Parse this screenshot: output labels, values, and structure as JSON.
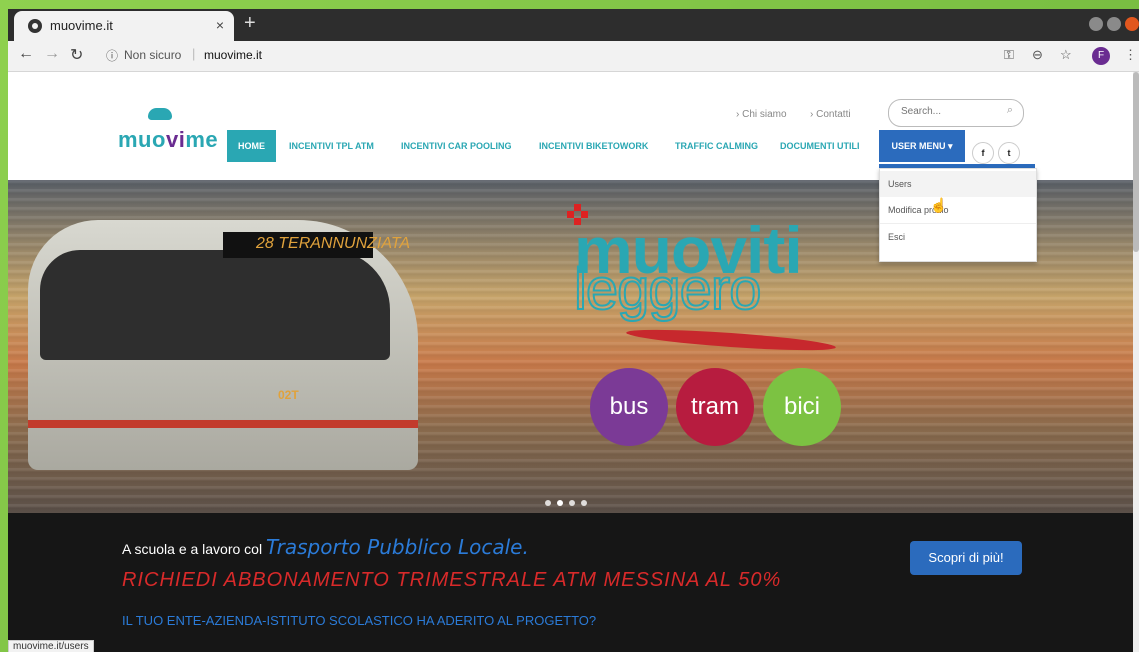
{
  "browser": {
    "tab_title": "muovime.it",
    "tab_close": "×",
    "new_tab": "+",
    "address_security": "Non sicuro",
    "address_url": "muovime.it",
    "profile_initial": "F",
    "status_url": "muovime.it/users"
  },
  "site": {
    "logo_text_a": "muo",
    "logo_text_b": "vi",
    "logo_text_c": "me",
    "top_links": [
      "› Chi siamo",
      "› Contatti"
    ],
    "search_placeholder": "Search...",
    "menu": [
      "HOME",
      "INCENTIVI TPL ATM",
      "INCENTIVI CAR POOLING",
      "INCENTIVI BIKETOWORK",
      "TRAFFIC CALMING",
      "DOCUMENTI UTILI",
      "USER MENU ▾"
    ],
    "social": [
      "f",
      "t"
    ],
    "user_menu_items": [
      "Users",
      "Modifica profilo",
      "Esci"
    ]
  },
  "hero": {
    "tram_destination": "28 TERANNUNZIATA",
    "tram_code": "02T",
    "headline": "muoviti",
    "subheadline": "leggero",
    "circles": [
      "bus",
      "tram",
      "bici"
    ],
    "circle_colors": [
      "#7b3a96",
      "#b71c3f",
      "#7cc242"
    ],
    "slide_count": 4,
    "active_slide": 2
  },
  "band": {
    "lead": "A scuola e a lavoro col",
    "lead_script": "Trasporto Pubblico Locale.",
    "promo": "RICHIEDI ABBONAMENTO TRIMESTRALE ATM MESSINA AL 50%",
    "question": "IL TUO ENTE-AZIENDA-ISTITUTO SCOLASTICO HA ADERITO AL PROGETTO?",
    "cta": "Scopri di più!"
  }
}
